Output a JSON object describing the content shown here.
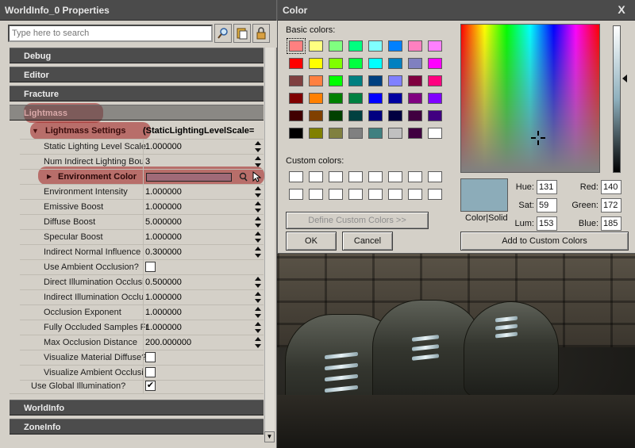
{
  "viewport": {
    "description_hidden": ""
  },
  "props": {
    "title": "WorldInfo_0 Properties",
    "search_placeholder": "Type here to search",
    "categories": {
      "debug": "Debug",
      "editor": "Editor",
      "fracture": "Fracture",
      "lightmass": "Lightmass",
      "worldinfo": "WorldInfo",
      "zoneinfo": "ZoneInfo"
    },
    "lightmass_settings": {
      "label": "Lightmass Settings",
      "value": "(StaticLightingLevelScale=",
      "rows": [
        {
          "label": "Static Lighting Level Scale",
          "value": "1.000000"
        },
        {
          "label": "Num Indirect Lighting Bou",
          "value": "3"
        },
        {
          "label": "Environment Color",
          "value": ""
        },
        {
          "label": "Environment Intensity",
          "value": "1.000000"
        },
        {
          "label": "Emissive Boost",
          "value": "1.000000"
        },
        {
          "label": "Diffuse Boost",
          "value": "5.000000"
        },
        {
          "label": "Specular Boost",
          "value": "1.000000"
        },
        {
          "label": "Indirect Normal Influence",
          "value": "0.300000"
        },
        {
          "label": "Use Ambient Occlusion?",
          "value": ""
        },
        {
          "label": "Direct Illumination Occlusi",
          "value": "0.500000"
        },
        {
          "label": "Indirect Illumination Occlu",
          "value": "1.000000"
        },
        {
          "label": "Occlusion Exponent",
          "value": "1.000000"
        },
        {
          "label": "Fully Occluded Samples Fr",
          "value": "1.000000"
        },
        {
          "label": "Max Occlusion Distance",
          "value": "200.000000"
        },
        {
          "label": "Visualize Material Diffuse?",
          "value": ""
        },
        {
          "label": "Visualize Ambient Occlusi",
          "value": ""
        }
      ]
    },
    "use_global_illumination": {
      "label": "Use Global Illumination?",
      "checked": "✔"
    },
    "environment_color_hex": "#a06a78"
  },
  "color": {
    "title": "Color",
    "close": "X",
    "basic_colors_label": "Basic colors:",
    "custom_colors_label": "Custom colors:",
    "define_custom": "Define Custom Colors >>",
    "ok": "OK",
    "cancel": "Cancel",
    "add_to_custom": "Add to Custom Colors",
    "color_solid": "Color|Solid",
    "hue_label": "Hue:",
    "hue": "131",
    "sat_label": "Sat:",
    "sat": "59",
    "lum_label": "Lum:",
    "lum": "153",
    "red_label": "Red:",
    "red": "140",
    "green_label": "Green:",
    "green": "172",
    "blue_label": "Blue:",
    "blue": "185",
    "preview_hex": "#8cacb9",
    "basic_swatches": [
      [
        "#ff8080",
        "#ffff80",
        "#80ff80",
        "#00ff80",
        "#80ffff",
        "#0080ff",
        "#ff80c0",
        "#ff80ff"
      ],
      [
        "#ff0000",
        "#ffff00",
        "#80ff00",
        "#00ff40",
        "#00ffff",
        "#0080c0",
        "#8080c0",
        "#ff00ff"
      ],
      [
        "#804040",
        "#ff8040",
        "#00ff00",
        "#008080",
        "#004080",
        "#8080ff",
        "#800040",
        "#ff0080"
      ],
      [
        "#800000",
        "#ff8000",
        "#008000",
        "#008040",
        "#0000ff",
        "#0000a0",
        "#800080",
        "#8000ff"
      ],
      [
        "#400000",
        "#804000",
        "#004000",
        "#004040",
        "#000080",
        "#000040",
        "#400040",
        "#400080"
      ],
      [
        "#000000",
        "#808000",
        "#808040",
        "#808080",
        "#408080",
        "#c0c0c0",
        "#400040",
        "#ffffff"
      ]
    ]
  }
}
